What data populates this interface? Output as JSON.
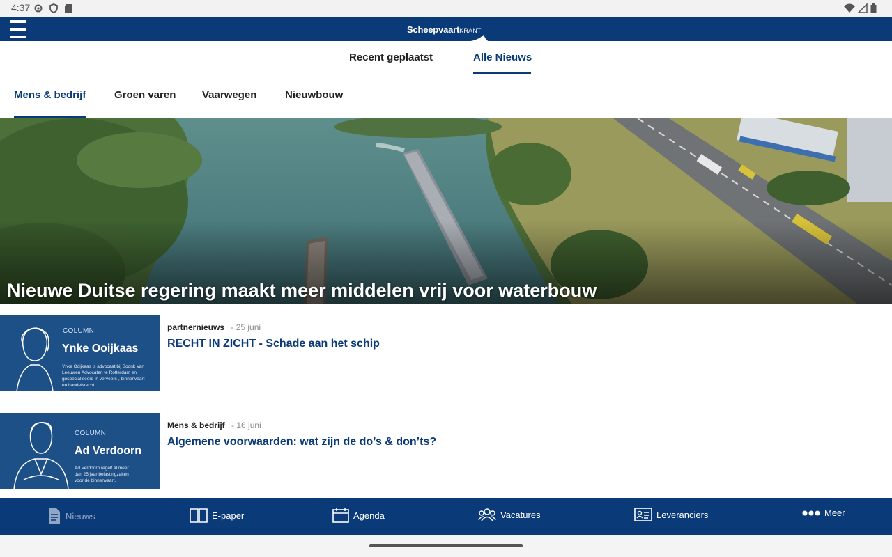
{
  "status_bar": {
    "time": "4:37",
    "left_icons": [
      "gear-icon",
      "shield-icon",
      "sd-card-icon"
    ],
    "right_icons": [
      "wifi-icon",
      "signal-icon",
      "battery-icon"
    ]
  },
  "header": {
    "logo_main": "Scheepvaart",
    "logo_sub": "KRANT",
    "brand_color": "#0b3a78"
  },
  "primary_tabs": [
    {
      "label": "Recent geplaatst",
      "active": false
    },
    {
      "label": "Alle Nieuws",
      "active": true
    }
  ],
  "category_tabs": [
    {
      "label": "Mens & bedrijf",
      "active": true
    },
    {
      "label": "Groen varen",
      "active": false
    },
    {
      "label": "Vaarwegen",
      "active": false
    },
    {
      "label": "Nieuwbouw",
      "active": false
    }
  ],
  "hero": {
    "title": "Nieuwe Duitse regering maakt meer middelen vrij voor waterbouw"
  },
  "articles": [
    {
      "category": "partnernieuws",
      "date": "- 25 juni",
      "title": "RECHT IN ZICHT - Schade aan het schip",
      "thumb": {
        "label": "COLUMN",
        "name": "Ynke Ooijkaas",
        "desc": "Ynke Ooijkaas is advocaat bij Boonk Van Leeuwen Advocaten te Rotterdam en gespecialiseerd in verveers-, binnenvaart- en handelsrecht."
      }
    },
    {
      "category": "Mens & bedrijf",
      "date": "- 16 juni",
      "title": "Algemene voorwaarden: wat zijn de do’s & don’ts?",
      "thumb": {
        "label": "COLUMN",
        "name": "Ad Verdoorn",
        "desc": "Ad Verdoorn regelt al meer dan 25 jaar belastingzaken voor de binnenvaart."
      }
    }
  ],
  "bottom_nav": [
    {
      "label": "Nieuws",
      "icon": "document-icon",
      "active": true
    },
    {
      "label": "E-paper",
      "icon": "book-icon",
      "active": false
    },
    {
      "label": "Agenda",
      "icon": "calendar-icon",
      "active": false
    },
    {
      "label": "Vacatures",
      "icon": "people-icon",
      "active": false
    },
    {
      "label": "Leveranciers",
      "icon": "id-card-icon",
      "active": false
    },
    {
      "label": "Meer",
      "icon": "more-dots-icon",
      "active": false
    }
  ]
}
